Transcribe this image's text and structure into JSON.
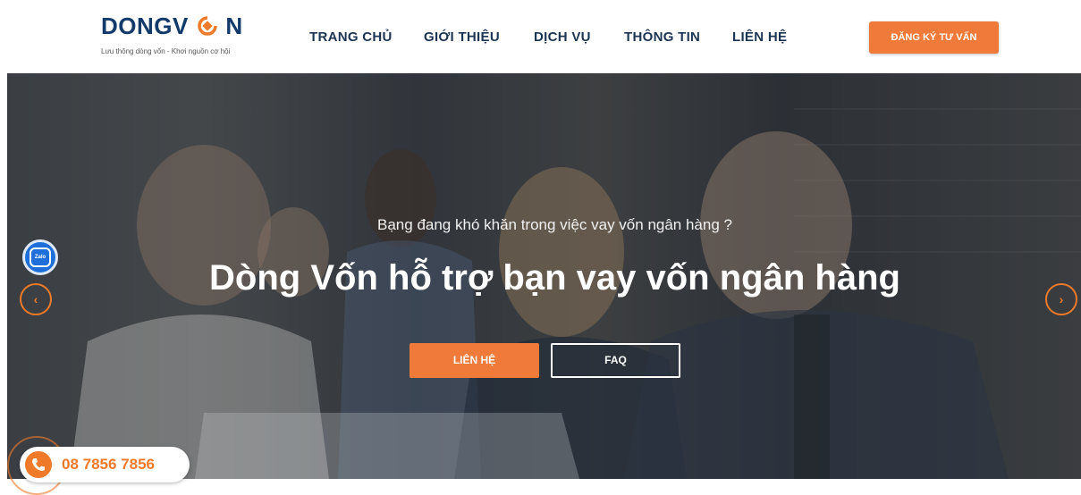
{
  "header": {
    "logo": {
      "wordmark": "DONGV",
      "wordmark_tail": "N",
      "tagline": "Lưu thông dòng vốn - Khơi nguồn cơ hội"
    },
    "nav": [
      {
        "label": "TRANG CHỦ"
      },
      {
        "label": "GIỚI THIỆU"
      },
      {
        "label": "DỊCH VỤ"
      },
      {
        "label": "THÔNG TIN"
      },
      {
        "label": "LIÊN HỆ"
      }
    ],
    "cta_label": "ĐĂNG KÝ TƯ VẤN"
  },
  "hero": {
    "subtitle": "Bạng đang khó khăn trong việc vay vốn ngân hàng ?",
    "title": "Dòng Vốn hỗ trợ bạn vay vốn ngân hàng",
    "primary_button": "LIÊN HỆ",
    "secondary_button": "FAQ",
    "prev_icon": "chevron-left-icon",
    "next_icon": "chevron-right-icon"
  },
  "floating": {
    "zalo_label": "Zalo",
    "phone_number": "08 7856 7856"
  },
  "colors": {
    "accent": "#ef7a3a",
    "brand_navy": "#123a6b",
    "nav_text": "#1c3553"
  }
}
